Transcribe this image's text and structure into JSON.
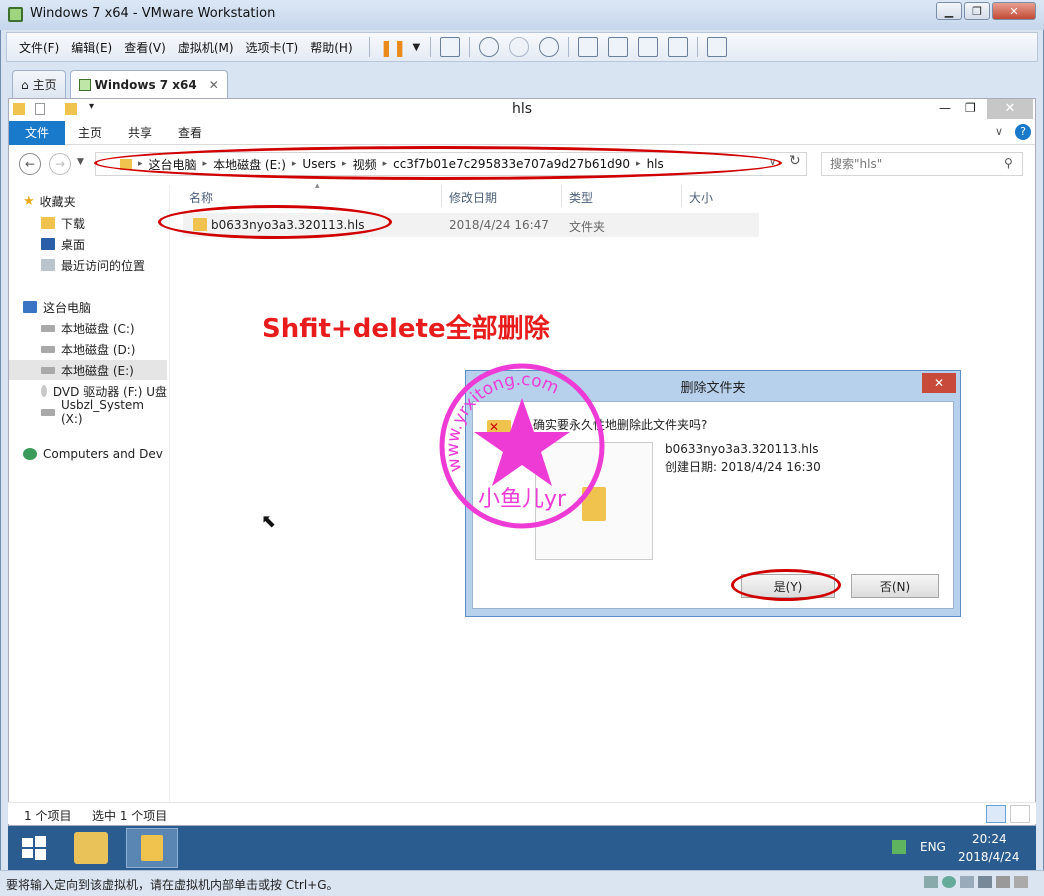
{
  "vmware": {
    "title": "Windows 7 x64 - VMware Workstation",
    "menus": [
      "文件(F)",
      "编辑(E)",
      "查看(V)",
      "虚拟机(M)",
      "选项卡(T)",
      "帮助(H)"
    ],
    "tabs": [
      {
        "label": "主页"
      },
      {
        "label": "Windows 7 x64"
      }
    ],
    "status_hint": "要将输入定向到该虚拟机，请在虚拟机内部单击或按 Ctrl+G。"
  },
  "explorer": {
    "title": "hls",
    "ribbon_tabs": [
      "文件",
      "主页",
      "共享",
      "查看"
    ],
    "breadcrumb": [
      "这台电脑",
      "本地磁盘 (E:)",
      "Users",
      "视频",
      "cc3f7b01e7c295833e707a9d27b61d90",
      "hls"
    ],
    "search_placeholder": "搜索\"hls\"",
    "nav": {
      "favorites_label": "收藏夹",
      "favorites": [
        "下载",
        "桌面",
        "最近访问的位置"
      ],
      "computer_label": "这台电脑",
      "drives": [
        "本地磁盘 (C:)",
        "本地磁盘 (D:)",
        "本地磁盘 (E:)",
        "DVD 驱动器 (F:) U盘",
        "Usbzl_System (X:)"
      ],
      "network_label": "Computers and Dev"
    },
    "columns": [
      "名称",
      "修改日期",
      "类型",
      "大小"
    ],
    "files": [
      {
        "name": "b0633nyo3a3.320113.hls",
        "date": "2018/4/24 16:47",
        "type": "文件夹",
        "size": ""
      }
    ],
    "status_items": "1 个项目",
    "status_selected": "选中 1 个项目"
  },
  "annotation": "Shfit+delete全部删除",
  "dialog": {
    "title": "删除文件夹",
    "question": "确实要永久性地删除此文件夹吗?",
    "item_name": "b0633nyo3a3.320113.hls",
    "item_created": "创建日期: 2018/4/24 16:30",
    "yes_label": "是(Y)",
    "no_label": "否(N)"
  },
  "taskbar": {
    "lang": "ENG",
    "time": "20:24",
    "date": "2018/4/24"
  },
  "watermark": {
    "url": "www.yrxitong.com",
    "name": "小鱼儿yr"
  },
  "colors": {
    "accent": "#1979ca",
    "annotation_red": "#e81c1c",
    "ellipse_red": "#d10000",
    "watermark_pink": "#ee3bd6",
    "taskbar_blue": "#2b5c8f"
  }
}
